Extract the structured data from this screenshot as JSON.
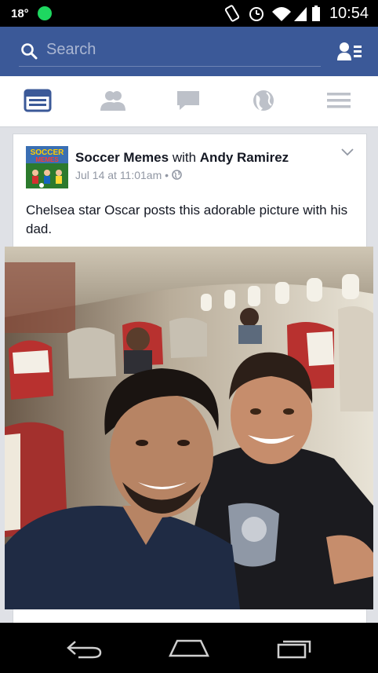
{
  "status_bar": {
    "temperature": "18°",
    "time": "10:54"
  },
  "search": {
    "placeholder": "Search"
  },
  "nav_tabs": [
    "news-feed",
    "friends",
    "messages",
    "notifications",
    "more"
  ],
  "post": {
    "page_name": "Soccer Memes",
    "with_text": "with",
    "tagged_name": "Andy Ramirez",
    "timestamp": "Jul 14 at 11:01am",
    "separator": "•",
    "message": "Chelsea star Oscar posts this adorable picture with his dad.",
    "avatar_text": "SOCCER MEMES"
  },
  "colors": {
    "brand": "#3b5998",
    "active_tab": "#3b5998",
    "inactive_tab": "#bdc1c9"
  }
}
